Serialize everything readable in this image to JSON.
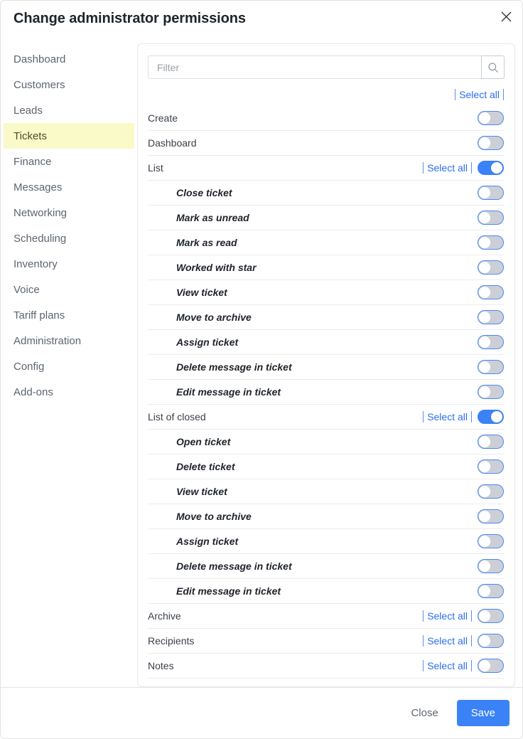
{
  "dialog": {
    "title": "Change administrator permissions",
    "close_icon": "close-icon"
  },
  "sidebar": {
    "items": [
      {
        "label": "Dashboard",
        "active": false
      },
      {
        "label": "Customers",
        "active": false
      },
      {
        "label": "Leads",
        "active": false
      },
      {
        "label": "Tickets",
        "active": true
      },
      {
        "label": "Finance",
        "active": false
      },
      {
        "label": "Messages",
        "active": false
      },
      {
        "label": "Networking",
        "active": false
      },
      {
        "label": "Scheduling",
        "active": false
      },
      {
        "label": "Inventory",
        "active": false
      },
      {
        "label": "Voice",
        "active": false
      },
      {
        "label": "Tariff plans",
        "active": false
      },
      {
        "label": "Administration",
        "active": false
      },
      {
        "label": "Config",
        "active": false
      },
      {
        "label": "Add-ons",
        "active": false
      }
    ],
    "highlight_color": "#fafac8"
  },
  "search": {
    "value": "",
    "placeholder": "Filter",
    "icon": "search-icon"
  },
  "top_select_all_label": "Select all",
  "select_all_label": "Select all",
  "accent_color": "#3b82f6",
  "permissions": [
    {
      "label": "Create",
      "sub": false,
      "select_all": false,
      "toggle": "off"
    },
    {
      "label": "Dashboard",
      "sub": false,
      "select_all": false,
      "toggle": "off"
    },
    {
      "label": "List",
      "sub": false,
      "select_all": true,
      "toggle": "on"
    },
    {
      "label": "Close ticket",
      "sub": true,
      "select_all": false,
      "toggle": "off"
    },
    {
      "label": "Mark as unread",
      "sub": true,
      "select_all": false,
      "toggle": "off"
    },
    {
      "label": "Mark as read",
      "sub": true,
      "select_all": false,
      "toggle": "off"
    },
    {
      "label": "Worked with star",
      "sub": true,
      "select_all": false,
      "toggle": "off"
    },
    {
      "label": "View ticket",
      "sub": true,
      "select_all": false,
      "toggle": "off"
    },
    {
      "label": "Move to archive",
      "sub": true,
      "select_all": false,
      "toggle": "off"
    },
    {
      "label": "Assign ticket",
      "sub": true,
      "select_all": false,
      "toggle": "off"
    },
    {
      "label": "Delete message in ticket",
      "sub": true,
      "select_all": false,
      "toggle": "off"
    },
    {
      "label": "Edit message in ticket",
      "sub": true,
      "select_all": false,
      "toggle": "off"
    },
    {
      "label": "List of closed",
      "sub": false,
      "select_all": true,
      "toggle": "on"
    },
    {
      "label": "Open ticket",
      "sub": true,
      "select_all": false,
      "toggle": "off"
    },
    {
      "label": "Delete ticket",
      "sub": true,
      "select_all": false,
      "toggle": "off"
    },
    {
      "label": "View ticket",
      "sub": true,
      "select_all": false,
      "toggle": "off"
    },
    {
      "label": "Move to archive",
      "sub": true,
      "select_all": false,
      "toggle": "off"
    },
    {
      "label": "Assign ticket",
      "sub": true,
      "select_all": false,
      "toggle": "off"
    },
    {
      "label": "Delete message in ticket",
      "sub": true,
      "select_all": false,
      "toggle": "off"
    },
    {
      "label": "Edit message in ticket",
      "sub": true,
      "select_all": false,
      "toggle": "off"
    },
    {
      "label": "Archive",
      "sub": false,
      "select_all": true,
      "toggle": "off"
    },
    {
      "label": "Recipients",
      "sub": false,
      "select_all": true,
      "toggle": "off"
    },
    {
      "label": "Notes",
      "sub": false,
      "select_all": true,
      "toggle": "off"
    }
  ],
  "footer": {
    "close_label": "Close",
    "save_label": "Save"
  }
}
